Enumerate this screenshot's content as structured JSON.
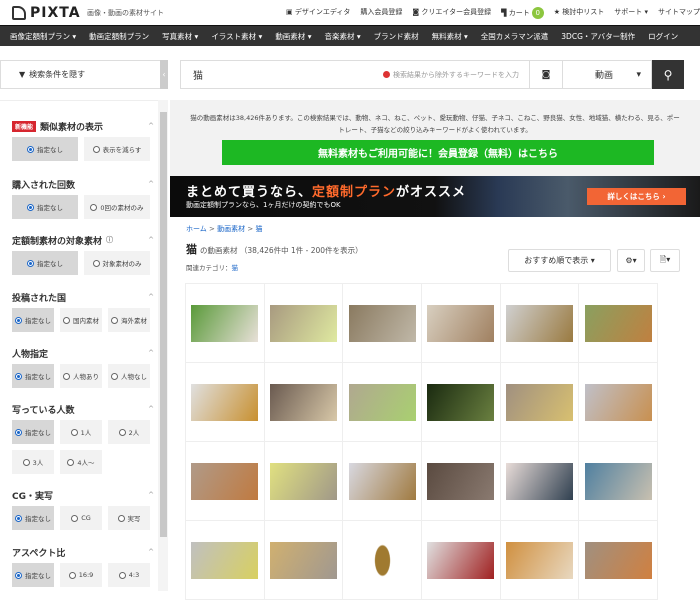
{
  "header": {
    "logo": "PIXTA",
    "tagline": "画像・動画の素材サイト",
    "links": [
      "デザインエディタ",
      "購入会員登録",
      "クリエイター会員登録",
      "カート",
      "検討中リスト",
      "サポート ▾",
      "サイトマップ"
    ],
    "cart_count": "0"
  },
  "nav": [
    "画像定額制プラン ▾",
    "動画定額制プラン",
    "写真素材 ▾",
    "イラスト素材 ▾",
    "動画素材 ▾",
    "音楽素材 ▾",
    "ブランド素材",
    "無料素材 ▾",
    "全国カメラマン派遣",
    "3DCG・アバター制作",
    "ログイン"
  ],
  "search": {
    "filter_toggle": "検索条件を隠す",
    "keyword": "猫",
    "exclude_placeholder": "検索結果から除外するキーワードを入力",
    "type": "動画"
  },
  "sidebar": [
    {
      "title": "類似素材の表示",
      "badge": "新機能",
      "options": [
        "指定なし",
        "表示を減らす"
      ],
      "selected": 0
    },
    {
      "title": "購入された回数",
      "options": [
        "指定なし",
        "0回の素材のみ"
      ],
      "selected": 0
    },
    {
      "title": "定額制素材の対象素材",
      "info": true,
      "options": [
        "指定なし",
        "対象素材のみ"
      ],
      "selected": 0
    },
    {
      "title": "投稿された国",
      "options": [
        "指定なし",
        "国内素材",
        "海外素材"
      ],
      "selected": 0
    },
    {
      "title": "人物指定",
      "options": [
        "指定なし",
        "人物あり",
        "人物なし"
      ],
      "selected": 0
    },
    {
      "title": "写っている人数",
      "options": [
        "指定なし",
        "1人",
        "2人",
        "3人",
        "4人～"
      ],
      "selected": 0
    },
    {
      "title": "CG・実写",
      "options": [
        "指定なし",
        "CG",
        "実写"
      ],
      "selected": 0
    },
    {
      "title": "アスペクト比",
      "options": [
        "指定なし",
        "16:9",
        "4:3"
      ],
      "selected": 0
    }
  ],
  "info": {
    "text": "猫の動画素材は38,426件あります。この検索結果では、動物、ネコ、ねこ、ペット、愛玩動物、仔猫、子ネコ、こねこ、野良猫、女性、地域猫、横たわる、見る、ポートレート、子猫などの絞り込みキーワードがよく使われています。",
    "cta": "無料素材もご利用可能に！会員登録（無料）はこちら"
  },
  "banner": {
    "title_a": "まとめて買うなら、",
    "title_hl": "定額制プラン",
    "title_b": "がオススメ",
    "sub": "動画定額制プランなら、1ヶ月だけの契約でもOK",
    "button": "詳しくはこちら ›",
    "accent": "#f26535"
  },
  "breadcrumb": [
    "ホーム",
    "動画素材",
    "猫"
  ],
  "results": {
    "keyword": "猫",
    "label": "の動画素材",
    "count": "（38,426件中 1件 - 200件を表示）",
    "category_label": "関連カテゴリ：",
    "category": "猫",
    "sort": "おすすめ順で表示 ▾",
    "settings": "⚙▾",
    "save": "🗎▾"
  },
  "thumbs": [
    "#5a9a3a,#e8e0d8",
    "#a89a80,#dfe9a0",
    "#8a7a60,#c0b8a8",
    "#d8cfc0,#a08060",
    "#d0d0d0,#9a7a40",
    "#8aa060,#c08040",
    "#e0e0e0,#c89030",
    "#6a5a50,#d8c8a8",
    "#b0a890,#a9d070",
    "#1a2a10,#6a8040",
    "#a09080,#d8c070",
    "#c0c0c8,#c89050",
    "#b09a88,#c07a40",
    "#e0e080,#a09888",
    "#d8d8e0,#a07a40",
    "#5a4a40,#8a7a70",
    "#e8dcd8,#304050",
    "#5080a0,#c8c0b0",
    "#c0c0c0,#d8d060",
    "#d0b070,#a09890",
    "#ffffff,#ffffff",
    "#e0e0e0,#a02020",
    "#d09040,#e8d8c0",
    "#a09080,#d08040"
  ]
}
